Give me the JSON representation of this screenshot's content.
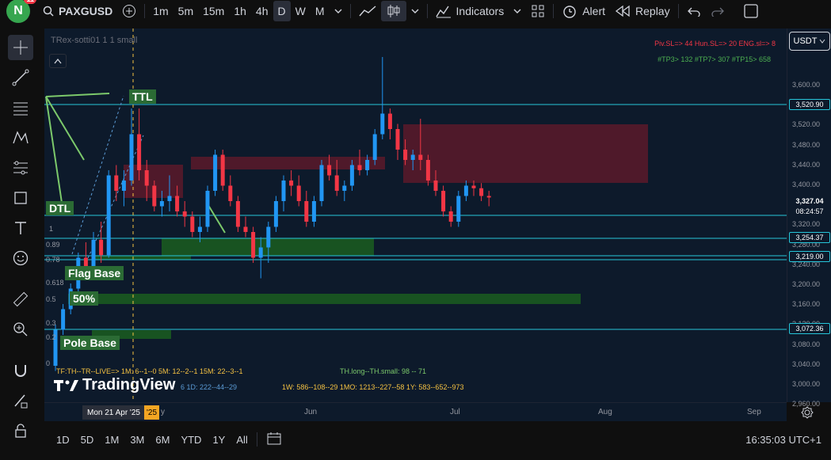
{
  "header": {
    "avatar_letter": "N",
    "notification_count": "11",
    "symbol": "PAXGUSD",
    "intervals": [
      "1m",
      "5m",
      "15m",
      "1h",
      "4h",
      "D",
      "W",
      "M"
    ],
    "selected_interval": "D",
    "indicators_label": "Indicators",
    "alert_label": "Alert",
    "replay_label": "Replay"
  },
  "chart": {
    "title": "TRex-sotti01 1 1 small",
    "info_line1": "Piv.SL=> 44  Hun.SL=> 20  ENG.sl=> 8",
    "info_line2": "#TP3> 132  #TP7> 307  #TP15> 658",
    "labels": {
      "ttl": "TTL",
      "dtl": "DTL",
      "flag_base": "Flag Base",
      "fifty": "50%",
      "pole_base": "Pole Base"
    },
    "fib_labels": {
      "one": "1",
      "p89": "0.89",
      "p78": "0.78",
      "p618": "0.618",
      "p5": "0.5",
      "p3": "0.3",
      "p2": "0.2",
      "zero": "0"
    },
    "stats_line1": "TF:TH--TR--LIVE=>  1M: 6--1--0   5M: 12--2--1   15M: 22--3--1",
    "stats_th": "TH.long--TH.small: 98 -- 71",
    "stats_line2a": "6   1D: 222--44--29",
    "stats_line2b": "1W: 586--108--29   1MO: 1213--227--58   1Y: 583--652--973",
    "watermark": "TradingView"
  },
  "price_axis": {
    "currency": "USDT",
    "ticks": [
      "3,600.00",
      "3,560.00",
      "3,520.00",
      "3,480.00",
      "3,440.00",
      "3,400.00",
      "3,360.00",
      "3,320.00",
      "3,280.00",
      "3,240.00",
      "3,200.00",
      "3,160.00",
      "3,120.00",
      "3,080.00",
      "3,040.00",
      "3,000.00",
      "2,960.00"
    ],
    "level_labels": [
      "3,520.90",
      "3,254.37",
      "3,219.00",
      "3,072.36"
    ],
    "current_price": "3,327.04",
    "countdown": "08:24:57"
  },
  "time_axis": {
    "crosshair_date": "Mon 21 Apr '25",
    "crosshair_year": "'25",
    "labels": [
      "y",
      "Jun",
      "Jul",
      "Aug",
      "Sep"
    ]
  },
  "bottom": {
    "ranges": [
      "1D",
      "5D",
      "1M",
      "3M",
      "6M",
      "YTD",
      "1Y",
      "All"
    ],
    "clock": "16:35:03 UTC+1"
  },
  "colors": {
    "up": "#2196f3",
    "down": "#f23645",
    "level_line": "#26c6da",
    "supply_zone": "#5c1a2a",
    "demand_zone": "#1b5e20"
  },
  "chart_data": {
    "type": "candlestick",
    "symbol": "PAXGUSD",
    "interval": "D",
    "ylim": [
      2960,
      3600
    ],
    "candles": [
      [
        3000,
        3080,
        2990,
        3070
      ],
      [
        3070,
        3120,
        3060,
        3110
      ],
      [
        3110,
        3160,
        3100,
        3150
      ],
      [
        3150,
        3220,
        3140,
        3210
      ],
      [
        3210,
        3240,
        3170,
        3190
      ],
      [
        3190,
        3260,
        3180,
        3245
      ],
      [
        3245,
        3280,
        3200,
        3215
      ],
      [
        3215,
        3380,
        3210,
        3370
      ],
      [
        3370,
        3390,
        3320,
        3340
      ],
      [
        3340,
        3380,
        3310,
        3360
      ],
      [
        3360,
        3500,
        3350,
        3450
      ],
      [
        3450,
        3500,
        3360,
        3380
      ],
      [
        3380,
        3400,
        3320,
        3350
      ],
      [
        3350,
        3360,
        3300,
        3310
      ],
      [
        3310,
        3340,
        3290,
        3320
      ],
      [
        3320,
        3370,
        3300,
        3330
      ],
      [
        3330,
        3350,
        3290,
        3300
      ],
      [
        3300,
        3320,
        3270,
        3290
      ],
      [
        3290,
        3300,
        3250,
        3260
      ],
      [
        3260,
        3290,
        3240,
        3270
      ],
      [
        3270,
        3350,
        3260,
        3340
      ],
      [
        3340,
        3420,
        3330,
        3410
      ],
      [
        3410,
        3420,
        3340,
        3350
      ],
      [
        3350,
        3370,
        3310,
        3320
      ],
      [
        3320,
        3330,
        3260,
        3270
      ],
      [
        3270,
        3290,
        3250,
        3260
      ],
      [
        3260,
        3270,
        3200,
        3210
      ],
      [
        3210,
        3250,
        3170,
        3230
      ],
      [
        3230,
        3280,
        3200,
        3270
      ],
      [
        3270,
        3330,
        3260,
        3320
      ],
      [
        3320,
        3370,
        3300,
        3360
      ],
      [
        3360,
        3380,
        3330,
        3350
      ],
      [
        3350,
        3370,
        3310,
        3320
      ],
      [
        3320,
        3340,
        3270,
        3280
      ],
      [
        3280,
        3330,
        3270,
        3320
      ],
      [
        3320,
        3400,
        3310,
        3390
      ],
      [
        3390,
        3410,
        3360,
        3370
      ],
      [
        3370,
        3400,
        3330,
        3340
      ],
      [
        3340,
        3360,
        3320,
        3350
      ],
      [
        3350,
        3400,
        3340,
        3390
      ],
      [
        3390,
        3420,
        3370,
        3380
      ],
      [
        3380,
        3410,
        3370,
        3400
      ],
      [
        3400,
        3460,
        3390,
        3450
      ],
      [
        3450,
        3600,
        3440,
        3490
      ],
      [
        3490,
        3500,
        3440,
        3460
      ],
      [
        3460,
        3470,
        3400,
        3420
      ],
      [
        3420,
        3440,
        3390,
        3400
      ],
      [
        3400,
        3420,
        3380,
        3410
      ],
      [
        3410,
        3480,
        3380,
        3400
      ],
      [
        3400,
        3410,
        3350,
        3360
      ],
      [
        3360,
        3380,
        3330,
        3340
      ],
      [
        3340,
        3350,
        3290,
        3300
      ],
      [
        3300,
        3310,
        3270,
        3280
      ],
      [
        3280,
        3340,
        3270,
        3330
      ],
      [
        3330,
        3360,
        3320,
        3350
      ],
      [
        3350,
        3360,
        3330,
        3345
      ],
      [
        3345,
        3355,
        3320,
        3330
      ],
      [
        3330,
        3340,
        3310,
        3327
      ]
    ],
    "levels": [
      3520.9,
      3254.37,
      3219.0,
      3072.36
    ],
    "current_price": 3327.04
  }
}
